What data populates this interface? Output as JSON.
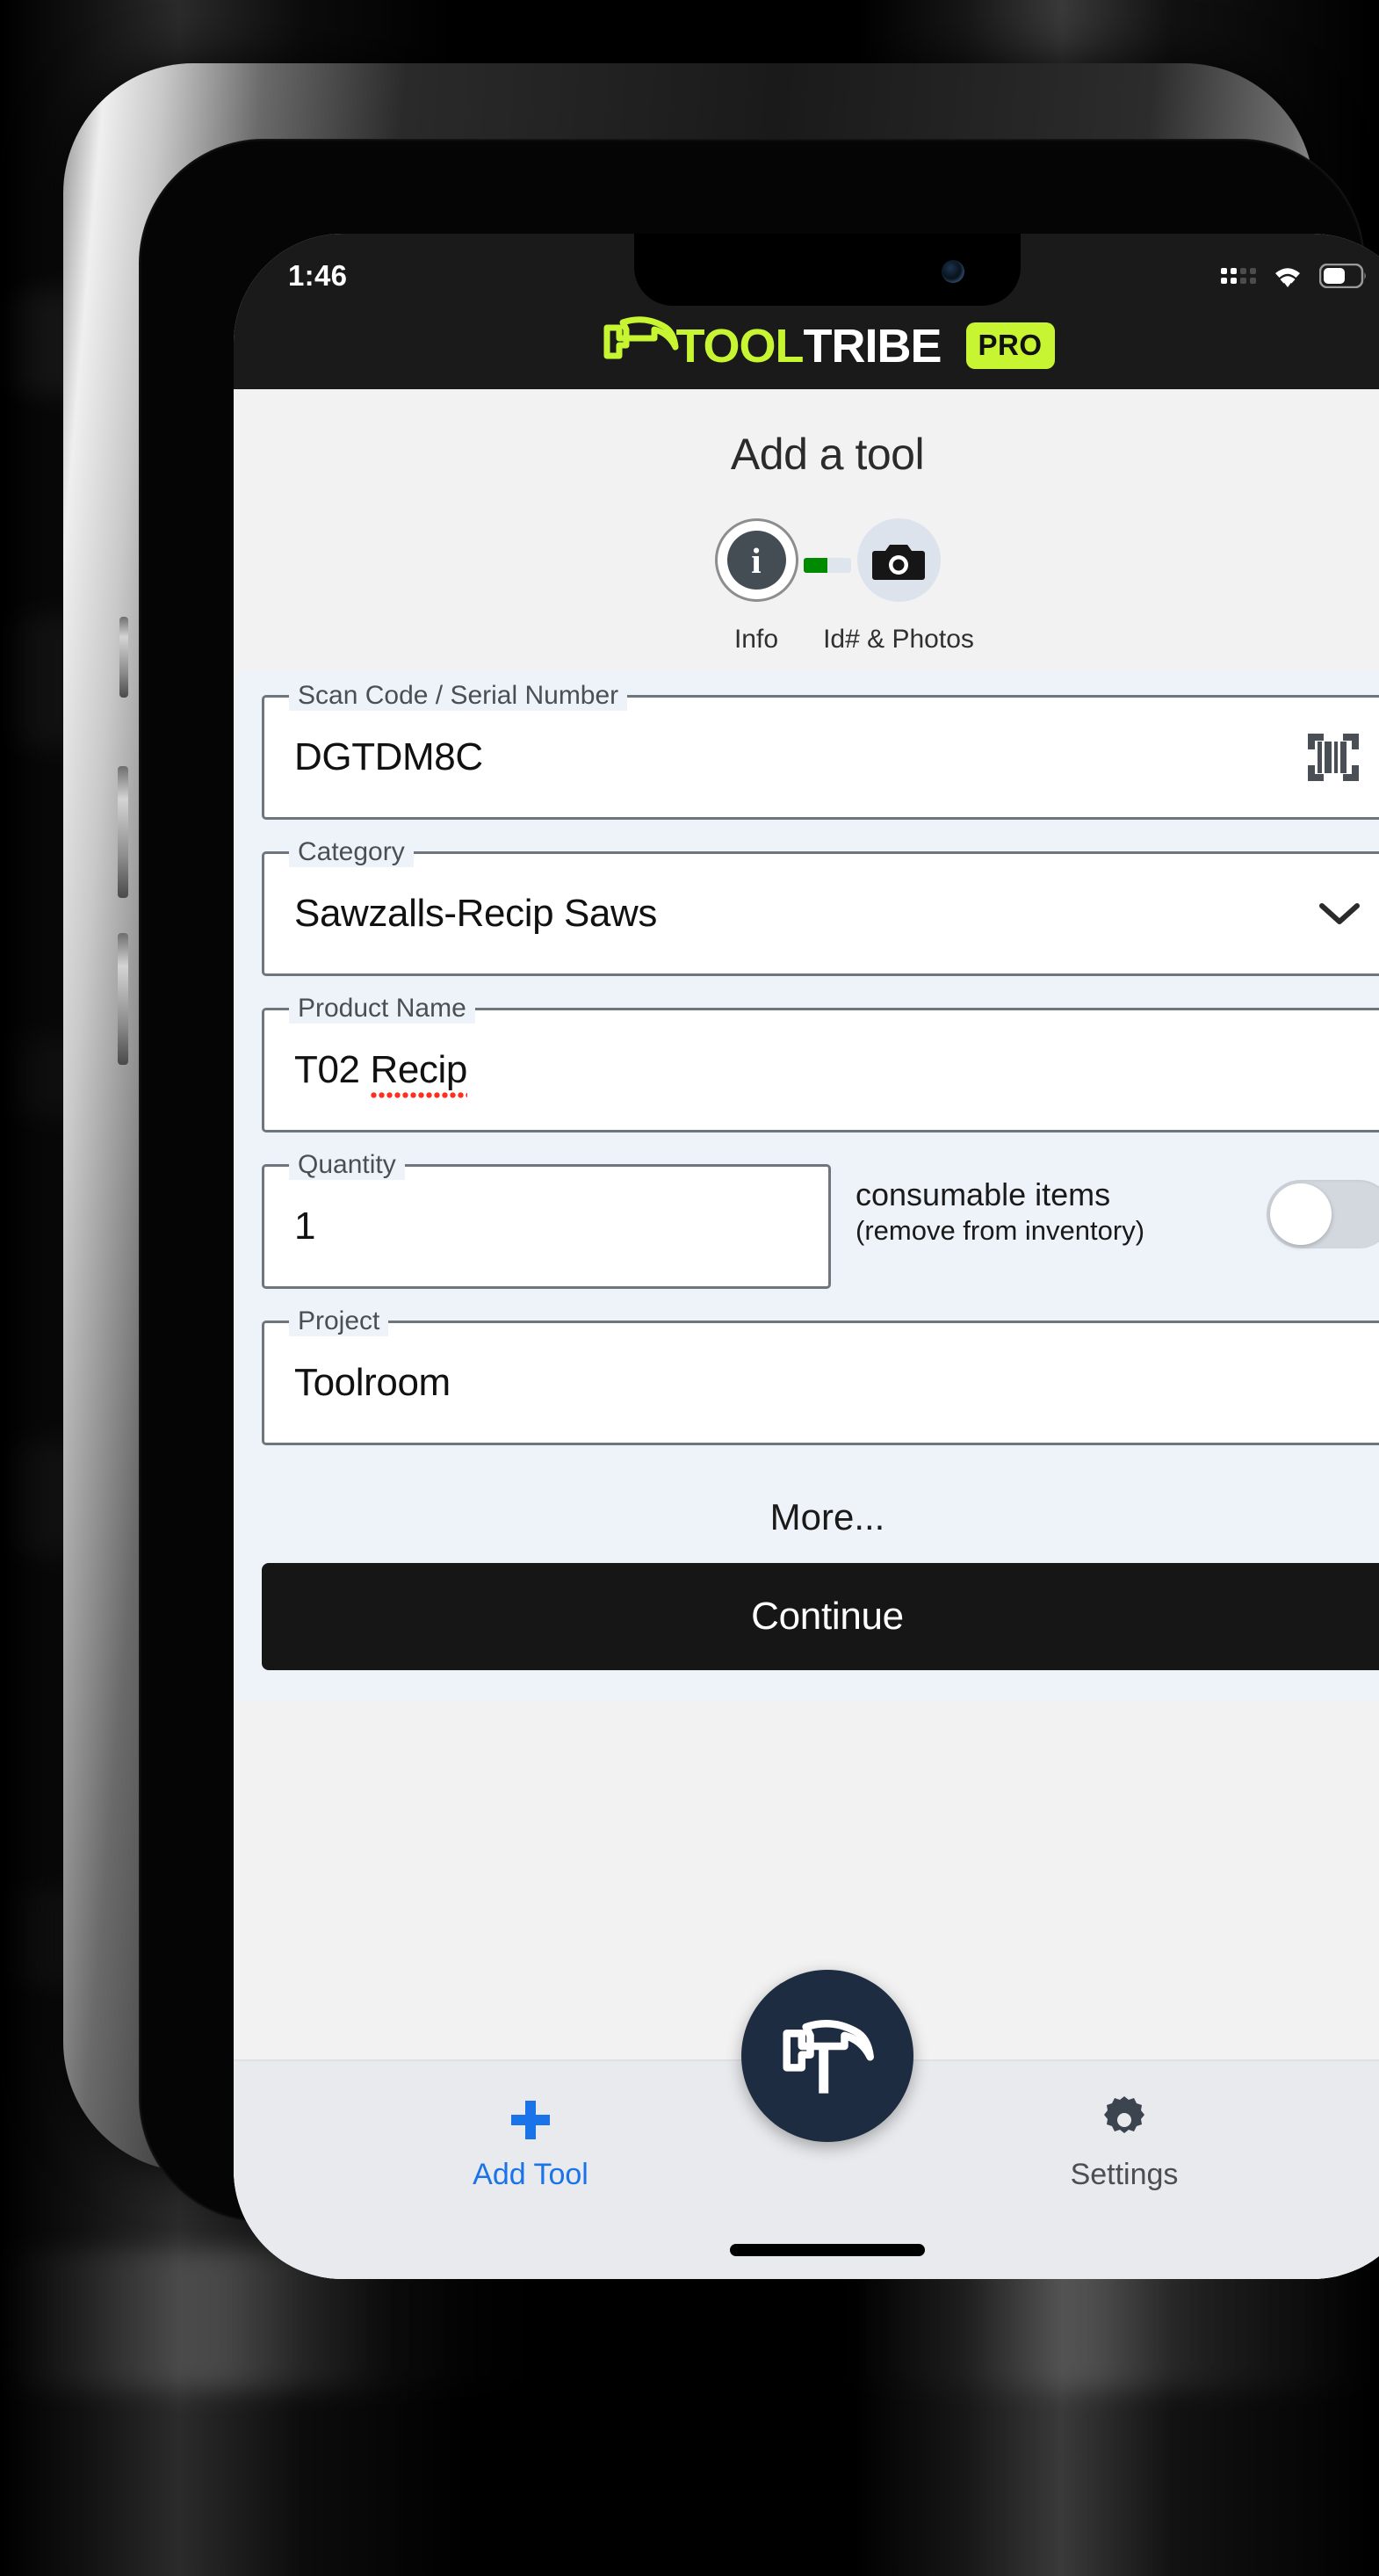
{
  "status_bar": {
    "time": "1:46",
    "cellular_icon": "cellular-signal-icon",
    "wifi_icon": "wifi-icon",
    "battery_icon": "battery-icon"
  },
  "brand": {
    "mark_icon": "hammer-logo-icon",
    "name_primary": "TOOL",
    "name_secondary": "TRIBE",
    "badge": "PRO",
    "accent_color": "#c8f532",
    "header_bg": "#1a1a1a"
  },
  "page": {
    "title": "Add a tool"
  },
  "stepper": {
    "steps": [
      {
        "label": "Info",
        "icon": "info-icon",
        "state": "active"
      },
      {
        "label": "Id# & Photos",
        "icon": "camera-icon",
        "state": "inactive"
      }
    ],
    "progress_percent": 50,
    "progress_color": "#008a00"
  },
  "form": {
    "fields": [
      {
        "label": "Scan Code / Serial Number",
        "value": "DGTDM8C",
        "trailing_icon": "barcode-scan-icon",
        "type": "text"
      },
      {
        "label": "Category",
        "value": "Sawzalls-Recip Saws",
        "trailing_icon": "chevron-down-icon",
        "type": "select"
      },
      {
        "label": "Product Name",
        "value_prefix": "T02 ",
        "value_misspelled": "Recip",
        "value": "T02 Recip",
        "type": "text"
      }
    ],
    "quantity": {
      "label": "Quantity",
      "value": "1"
    },
    "consumable": {
      "label_line1": "consumable",
      "label_line2": "items",
      "sublabel": "(remove from inventory)",
      "toggle_state": "off"
    },
    "project": {
      "label": "Project",
      "value": "Toolroom"
    },
    "more_label": "More...",
    "continue_label": "Continue"
  },
  "bottom_nav": {
    "items": [
      {
        "label": "Add Tool",
        "icon": "plus-icon",
        "active": true,
        "color": "#1a73e8"
      },
      {
        "label": "Settings",
        "icon": "gear-icon",
        "active": false,
        "color": "#4a4f55"
      }
    ],
    "center_button_icon": "hammer-logo-icon"
  }
}
